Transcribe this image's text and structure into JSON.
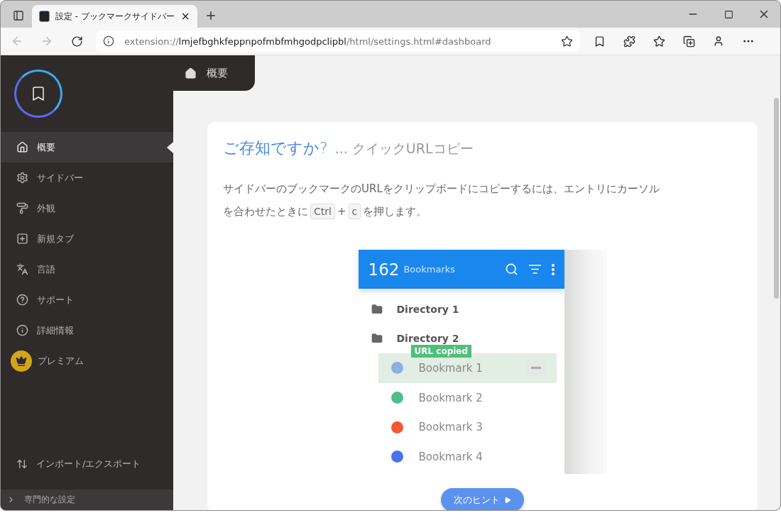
{
  "browser": {
    "tab": {
      "title": "設定 - ブックマークサイドバー"
    },
    "address": {
      "scheme": "extension://",
      "host": "lmjefbghkfeppnpofmbfmhgodpclipbl",
      "path": "/html/settings.html#dashboard"
    }
  },
  "sidebar": {
    "items": [
      {
        "label": "概要",
        "selected": true
      },
      {
        "label": "サイドバー",
        "selected": false
      },
      {
        "label": "外観",
        "selected": false
      },
      {
        "label": "新規タブ",
        "selected": false
      },
      {
        "label": "言語",
        "selected": false
      },
      {
        "label": "サポート",
        "selected": false
      },
      {
        "label": "詳細情報",
        "selected": false
      },
      {
        "label": "プレミアム",
        "selected": false
      }
    ],
    "import_export": "インポート/エクスポート",
    "advanced": "専門的な設定"
  },
  "breadcrumb": "概要",
  "tip": {
    "heading": "ご存知ですか?",
    "subheading": "... クイックURLコピー",
    "text_lines": [
      "サイドバーのブックマークのURLをクリップボードにコピーするには、エントリにカーソル",
      "を合わせたときに"
    ],
    "keys": [
      "Ctrl",
      "c"
    ],
    "plus": "+",
    "text_after": "を押します。"
  },
  "demo": {
    "count": "162",
    "label": "Bookmarks",
    "tooltip": "URL copied",
    "items": [
      {
        "kind": "folder",
        "label": "Directory 1"
      },
      {
        "kind": "folder",
        "label": "Directory 2"
      },
      {
        "kind": "bookmark",
        "label": "Bookmark 1",
        "color": "#8fb0dd",
        "selected": true
      },
      {
        "kind": "bookmark",
        "label": "Bookmark 2",
        "color": "#4fbf8a",
        "selected": false
      },
      {
        "kind": "bookmark",
        "label": "Bookmark 3",
        "color": "#f4572f",
        "selected": false
      },
      {
        "kind": "bookmark",
        "label": "Bookmark 4",
        "color": "#4a72f0",
        "selected": false
      }
    ]
  },
  "next_button": "次のヒント"
}
